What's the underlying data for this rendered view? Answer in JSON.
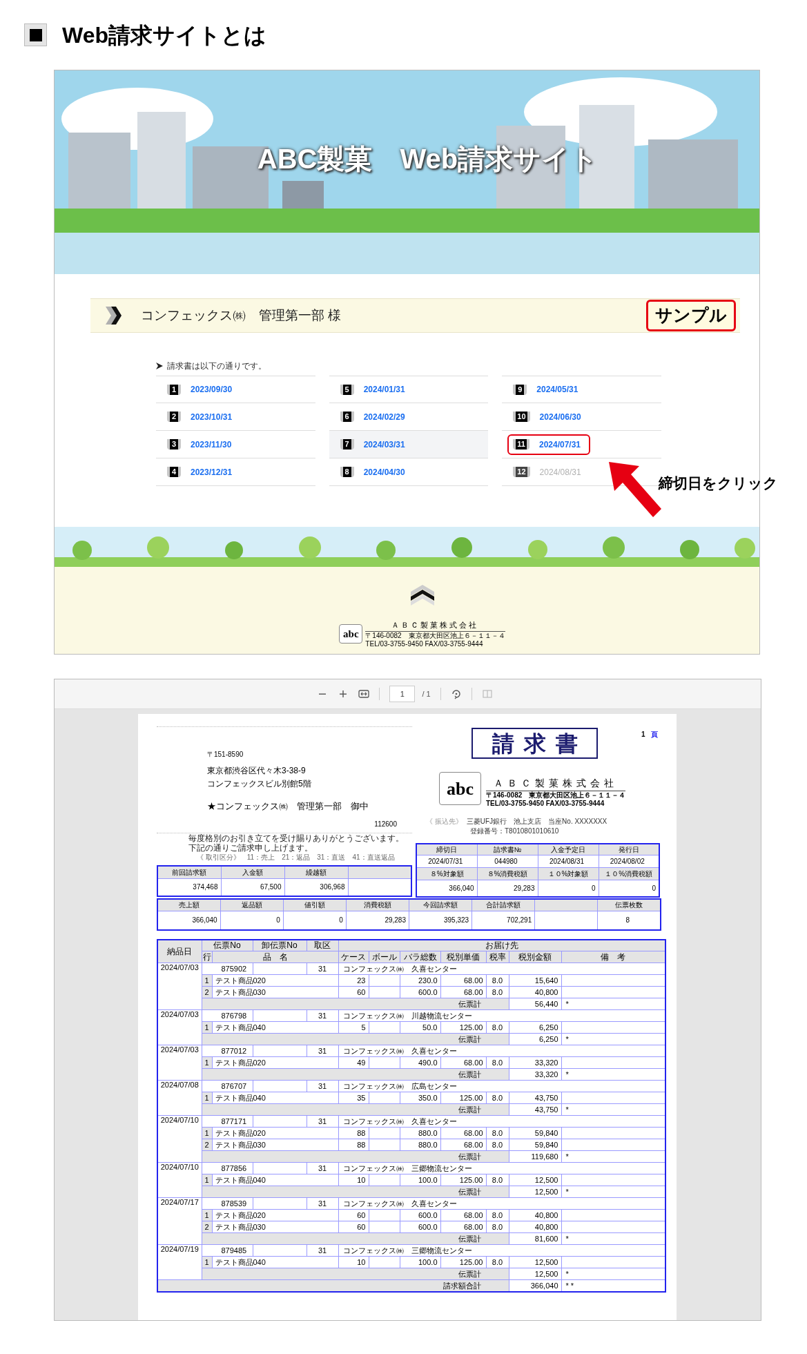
{
  "heading": {
    "title": "Web請求サイトとは"
  },
  "site": {
    "banner_title": "ABC製菓　Web請求サイト",
    "customer": "コンフェックス㈱　管理第一部 様",
    "sample_label": "サンプル",
    "intro": "請求書は以下の通りです。",
    "invoices": [
      {
        "number": "1",
        "date": "2023/09/30",
        "disabled": false,
        "hovered": false,
        "highlighted": false
      },
      {
        "number": "2",
        "date": "2023/10/31",
        "disabled": false,
        "hovered": false,
        "highlighted": false
      },
      {
        "number": "3",
        "date": "2023/11/30",
        "disabled": false,
        "hovered": false,
        "highlighted": false
      },
      {
        "number": "4",
        "date": "2023/12/31",
        "disabled": false,
        "hovered": false,
        "highlighted": false
      },
      {
        "number": "5",
        "date": "2024/01/31",
        "disabled": false,
        "hovered": false,
        "highlighted": false
      },
      {
        "number": "6",
        "date": "2024/02/29",
        "disabled": false,
        "hovered": false,
        "highlighted": false
      },
      {
        "number": "7",
        "date": "2024/03/31",
        "disabled": false,
        "hovered": true,
        "highlighted": false
      },
      {
        "number": "8",
        "date": "2024/04/30",
        "disabled": false,
        "hovered": false,
        "highlighted": false
      },
      {
        "number": "9",
        "date": "2024/05/31",
        "disabled": false,
        "hovered": false,
        "highlighted": false
      },
      {
        "number": "10",
        "date": "2024/06/30",
        "disabled": false,
        "hovered": false,
        "highlighted": false
      },
      {
        "number": "11",
        "date": "2024/07/31",
        "disabled": false,
        "hovered": false,
        "highlighted": true
      },
      {
        "number": "12",
        "date": "2024/08/31",
        "disabled": true,
        "hovered": false,
        "highlighted": false
      }
    ],
    "footer": {
      "logo": "abc",
      "company": "ＡＢＣ製菓株式会社",
      "address": "〒146-0082　東京都大田区池上６－１１－４",
      "contact": "TEL/03-3755-9450 FAX/03-3755-9444"
    }
  },
  "annotation": {
    "text": "締切日をクリック"
  },
  "viewer": {
    "page_input": "1",
    "page_total": "/ 1"
  },
  "invoice": {
    "title": "請求書",
    "page_no": "1",
    "page_unit": "頁",
    "recipient": {
      "postal": "〒151-8590",
      "address1": "東京都渋谷区代々木3-38-9",
      "address2": "コンフェックスビル別館5階",
      "name": "★コンフェックス㈱　管理第一部　御中",
      "code": "112600"
    },
    "issuer": {
      "logo": "abc",
      "company": "ＡＢＣ製菓株式会社",
      "address": "〒146-0082　東京都大田区池上６－１１－４",
      "contact": "TEL/03-3755-9450 FAX/03-3755-9444"
    },
    "bank_label": "《 振込先》",
    "bank": "三菱UFJ銀行　池上支店　当座No. XXXXXXX",
    "registration": "登録番号：T8010801010610",
    "greeting": [
      "毎度格別のお引き立てを受け賜りありがとうございます。",
      "下記の通りご請求申し上げます。"
    ],
    "codes": "《 取引区分》　11：売上　21：返品　31：直送　41：直送返品",
    "info_table": [
      {
        "label": "締切日",
        "value": "2024/07/31"
      },
      {
        "label": "請求書№",
        "value": "044980"
      },
      {
        "label": "入金予定日",
        "value": "2024/08/31"
      },
      {
        "label": "発行日",
        "value": "2024/08/02"
      }
    ],
    "tax_table": [
      {
        "label": "８%対象額",
        "value": "366,040"
      },
      {
        "label": "８%消費税額",
        "value": "29,283"
      },
      {
        "label": "１０%対象額",
        "value": "0"
      },
      {
        "label": "１０%消費税額",
        "value": "0"
      }
    ],
    "balance_table": [
      {
        "kind": "field",
        "label": "前回請求額",
        "value": "374,468"
      },
      {
        "kind": "field",
        "label": "入金額",
        "value": "67,500"
      },
      {
        "kind": "field",
        "label": "繰越額",
        "value": "306,968"
      },
      {
        "kind": "blank"
      }
    ],
    "summary_table": [
      {
        "kind": "field",
        "label": "売上額",
        "value": "366,040"
      },
      {
        "kind": "field",
        "label": "返品額",
        "value": "0"
      },
      {
        "kind": "field",
        "label": "値引額",
        "value": "0"
      },
      {
        "kind": "field",
        "label": "消費税額",
        "value": "29,283"
      },
      {
        "kind": "field",
        "label": "今回請求額",
        "value": "395,323"
      },
      {
        "kind": "field",
        "label": "合計請求額",
        "value": "702,291"
      },
      {
        "kind": "blank"
      },
      {
        "kind": "count",
        "label": "伝票枚数",
        "value": "8"
      }
    ],
    "detail_header": {
      "date": "納品日",
      "slip_no": "伝票No",
      "wholesale_no": "卸伝票No",
      "type": "取区",
      "destination": "お届け先",
      "line": "行",
      "name": "品　名",
      "cases": "ケース",
      "balls": "ボール",
      "pieces": "バラ総数",
      "unit_price": "税別単価",
      "tax_rate": "税率",
      "amount": "税別金額",
      "note": "備　考"
    },
    "slips": [
      {
        "date": "2024/07/03",
        "slip_no": "875902",
        "type": "31",
        "destination": "コンフェックス㈱　久喜センター",
        "total_label": "伝票計",
        "total": "56,440",
        "mark": "*",
        "items": [
          {
            "line": "1",
            "name": "テスト商品020",
            "cases": "23",
            "pieces": "230.0",
            "unit_price": "68.00",
            "tax_rate": "8.0",
            "amount": "15,640"
          },
          {
            "line": "2",
            "name": "テスト商品030",
            "cases": "60",
            "pieces": "600.0",
            "unit_price": "68.00",
            "tax_rate": "8.0",
            "amount": "40,800"
          }
        ]
      },
      {
        "date": "2024/07/03",
        "slip_no": "876798",
        "type": "31",
        "destination": "コンフェックス㈱　川越物流センター",
        "total_label": "伝票計",
        "total": "6,250",
        "mark": "*",
        "items": [
          {
            "line": "1",
            "name": "テスト商品040",
            "cases": "5",
            "pieces": "50.0",
            "unit_price": "125.00",
            "tax_rate": "8.0",
            "amount": "6,250"
          }
        ]
      },
      {
        "date": "2024/07/03",
        "slip_no": "877012",
        "type": "31",
        "destination": "コンフェックス㈱　久喜センター",
        "total_label": "伝票計",
        "total": "33,320",
        "mark": "*",
        "items": [
          {
            "line": "1",
            "name": "テスト商品020",
            "cases": "49",
            "pieces": "490.0",
            "unit_price": "68.00",
            "tax_rate": "8.0",
            "amount": "33,320"
          }
        ]
      },
      {
        "date": "2024/07/08",
        "slip_no": "876707",
        "type": "31",
        "destination": "コンフェックス㈱　広島センター",
        "total_label": "伝票計",
        "total": "43,750",
        "mark": "*",
        "items": [
          {
            "line": "1",
            "name": "テスト商品040",
            "cases": "35",
            "pieces": "350.0",
            "unit_price": "125.00",
            "tax_rate": "8.0",
            "amount": "43,750"
          }
        ]
      },
      {
        "date": "2024/07/10",
        "slip_no": "877171",
        "type": "31",
        "destination": "コンフェックス㈱　久喜センター",
        "total_label": "伝票計",
        "total": "119,680",
        "mark": "*",
        "items": [
          {
            "line": "1",
            "name": "テスト商品020",
            "cases": "88",
            "pieces": "880.0",
            "unit_price": "68.00",
            "tax_rate": "8.0",
            "amount": "59,840"
          },
          {
            "line": "2",
            "name": "テスト商品030",
            "cases": "88",
            "pieces": "880.0",
            "unit_price": "68.00",
            "tax_rate": "8.0",
            "amount": "59,840"
          }
        ]
      },
      {
        "date": "2024/07/10",
        "slip_no": "877856",
        "type": "31",
        "destination": "コンフェックス㈱　三郷物流センター",
        "total_label": "伝票計",
        "total": "12,500",
        "mark": "*",
        "items": [
          {
            "line": "1",
            "name": "テスト商品040",
            "cases": "10",
            "pieces": "100.0",
            "unit_price": "125.00",
            "tax_rate": "8.0",
            "amount": "12,500"
          }
        ]
      },
      {
        "date": "2024/07/17",
        "slip_no": "878539",
        "type": "31",
        "destination": "コンフェックス㈱　久喜センター",
        "total_label": "伝票計",
        "total": "81,600",
        "mark": "*",
        "items": [
          {
            "line": "1",
            "name": "テスト商品020",
            "cases": "60",
            "pieces": "600.0",
            "unit_price": "68.00",
            "tax_rate": "8.0",
            "amount": "40,800"
          },
          {
            "line": "2",
            "name": "テスト商品030",
            "cases": "60",
            "pieces": "600.0",
            "unit_price": "68.00",
            "tax_rate": "8.0",
            "amount": "40,800"
          }
        ]
      },
      {
        "date": "2024/07/19",
        "slip_no": "879485",
        "type": "31",
        "destination": "コンフェックス㈱　三郷物流センター",
        "total_label": "伝票計",
        "total": "12,500",
        "mark": "*",
        "items": [
          {
            "line": "1",
            "name": "テスト商品040",
            "cases": "10",
            "pieces": "100.0",
            "unit_price": "125.00",
            "tax_rate": "8.0",
            "amount": "12,500"
          }
        ]
      }
    ],
    "grand_total_label": "請求額合計",
    "grand_total": "366,040",
    "grand_mark": "* *"
  }
}
